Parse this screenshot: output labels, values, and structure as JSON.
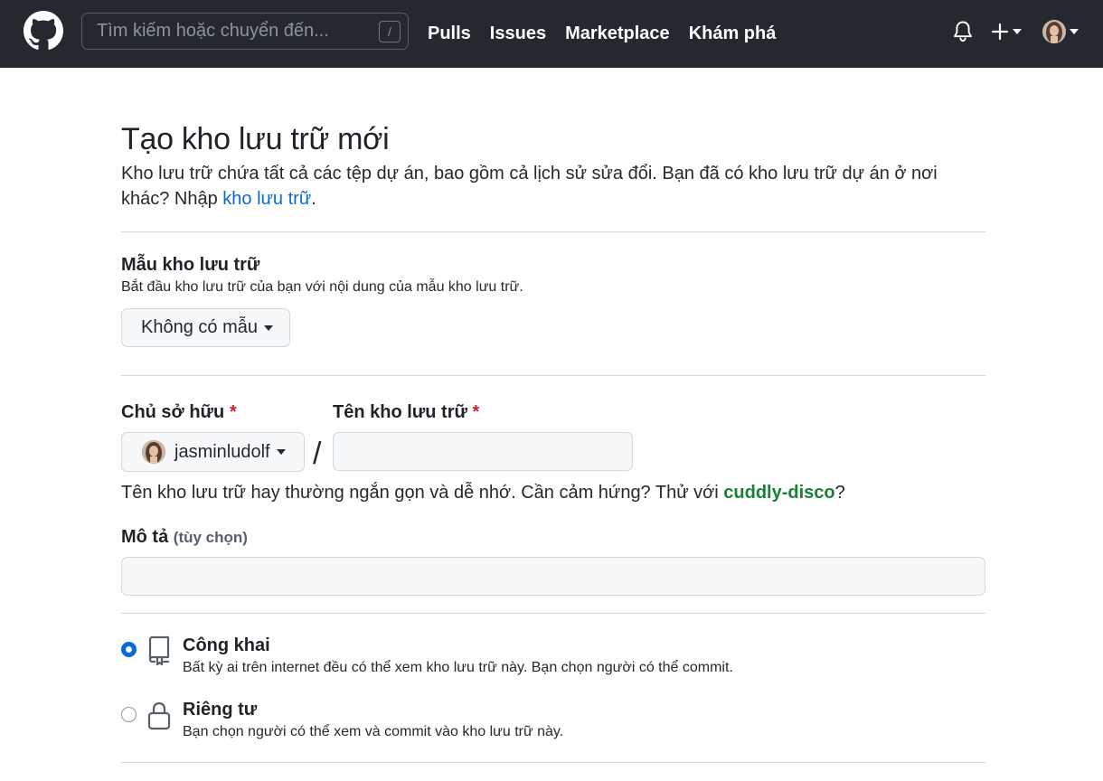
{
  "header": {
    "search_placeholder": "Tìm kiếm hoặc chuyển đến...",
    "search_shortcut": "/",
    "nav": [
      "Pulls",
      "Issues",
      "Marketplace",
      "Khám phá"
    ]
  },
  "page": {
    "title": "Tạo kho lưu trữ mới",
    "intro_text": "Kho lưu trữ chứa tất cả các tệp dự án, bao gồm cả lịch sử sửa đổi. Bạn đã có kho lưu trữ dự án ở nơi khác? Nhập ",
    "intro_link": "kho lưu trữ",
    "intro_end": "."
  },
  "template": {
    "label": "Mẫu kho lưu trữ",
    "note": "Bắt đầu kho lưu trữ của bạn với nội dung của mẫu kho lưu trữ.",
    "button": "Không có mẫu"
  },
  "owner": {
    "label": "Chủ sở hữu",
    "required": "*",
    "value": "jasminludolf"
  },
  "repo_name": {
    "label": "Tên kho lưu trữ",
    "required": "*",
    "separator": "/",
    "value": "",
    "hint_prefix": "Tên kho lưu trữ hay thường ngắn gọn và dễ nhớ. Cần cảm hứng? Thử với ",
    "hint_suggestion": "cuddly-disco",
    "hint_suffix": "?"
  },
  "description": {
    "label": "Mô tả",
    "optional": "(tùy chọn)",
    "value": ""
  },
  "visibility": {
    "selected": "public",
    "public_title": "Công khai",
    "public_desc": "Bất kỳ ai trên internet đều có thể xem kho lưu trữ này. Bạn chọn người có thể commit.",
    "private_title": "Riêng tư",
    "private_desc": "Bạn chọn người có thể xem và commit vào kho lưu trữ này."
  },
  "colors": {
    "header_bg": "#24292f",
    "link": "#0969da",
    "suggestion": "#1a7f37",
    "required": "#cf222e"
  }
}
